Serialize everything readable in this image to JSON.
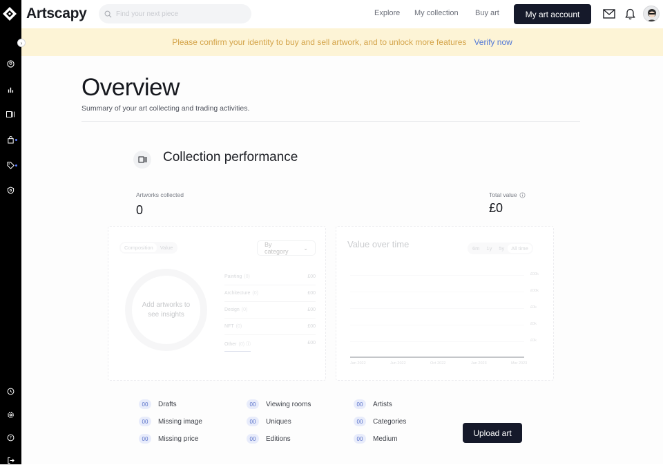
{
  "brand": {
    "name": "Artscapy"
  },
  "search": {
    "placeholder": "Find your next piece"
  },
  "nav": {
    "explore": "Explore",
    "collection": "My collection",
    "buy": "Buy art",
    "account": "My art account"
  },
  "banner": {
    "message": "Please confirm your identity to buy and sell artwork, and to unlock more features",
    "link": "Verify now"
  },
  "page": {
    "title": "Overview",
    "subtitle": "Summary of your art collecting and trading activities."
  },
  "performance": {
    "title": "Collection performance",
    "artworks_label": "Artworks collected",
    "artworks_value": "0",
    "total_label": "Total value",
    "total_value": "£0"
  },
  "composition": {
    "toggle": [
      "Composition",
      "Value"
    ],
    "dropdown": "By category",
    "donut_text": "Add artworks to see insights",
    "legend": [
      {
        "label": "Painting",
        "pct": "(0)",
        "value": "£00"
      },
      {
        "label": "Architecture",
        "pct": "(0)",
        "value": "£00"
      },
      {
        "label": "Design",
        "pct": "(0)",
        "value": "£00"
      },
      {
        "label": "NFT",
        "pct": "(0)",
        "value": "£00"
      },
      {
        "label": "Other",
        "pct": "(0)",
        "value": "£00"
      }
    ]
  },
  "value_over_time": {
    "title": "Value over time",
    "ranges": [
      "6m",
      "1y",
      "5y",
      "All time"
    ],
    "y_ticks": [
      "£00k",
      "£00k",
      "£0k",
      "£0k",
      "£0k"
    ],
    "x_ticks": [
      "Jan 2022",
      "Jun 2022",
      "Oct 2022",
      "Jan 2023",
      "Mar 2023"
    ]
  },
  "counts": {
    "col1": [
      {
        "n": "00",
        "label": "Drafts"
      },
      {
        "n": "00",
        "label": "Missing image"
      },
      {
        "n": "00",
        "label": "Missing price"
      }
    ],
    "col2": [
      {
        "n": "00",
        "label": "Viewing rooms"
      },
      {
        "n": "00",
        "label": "Uniques"
      },
      {
        "n": "00",
        "label": "Editions"
      }
    ],
    "col3": [
      {
        "n": "00",
        "label": "Artists"
      },
      {
        "n": "00",
        "label": "Categories"
      },
      {
        "n": "00",
        "label": "Medium"
      }
    ]
  },
  "actions": {
    "upload": "Upload art"
  },
  "colors": {
    "primary_dark": "#15192a",
    "banner_bg": "#fdf4d6",
    "banner_text": "#d4a44a",
    "link": "#5177d6"
  }
}
